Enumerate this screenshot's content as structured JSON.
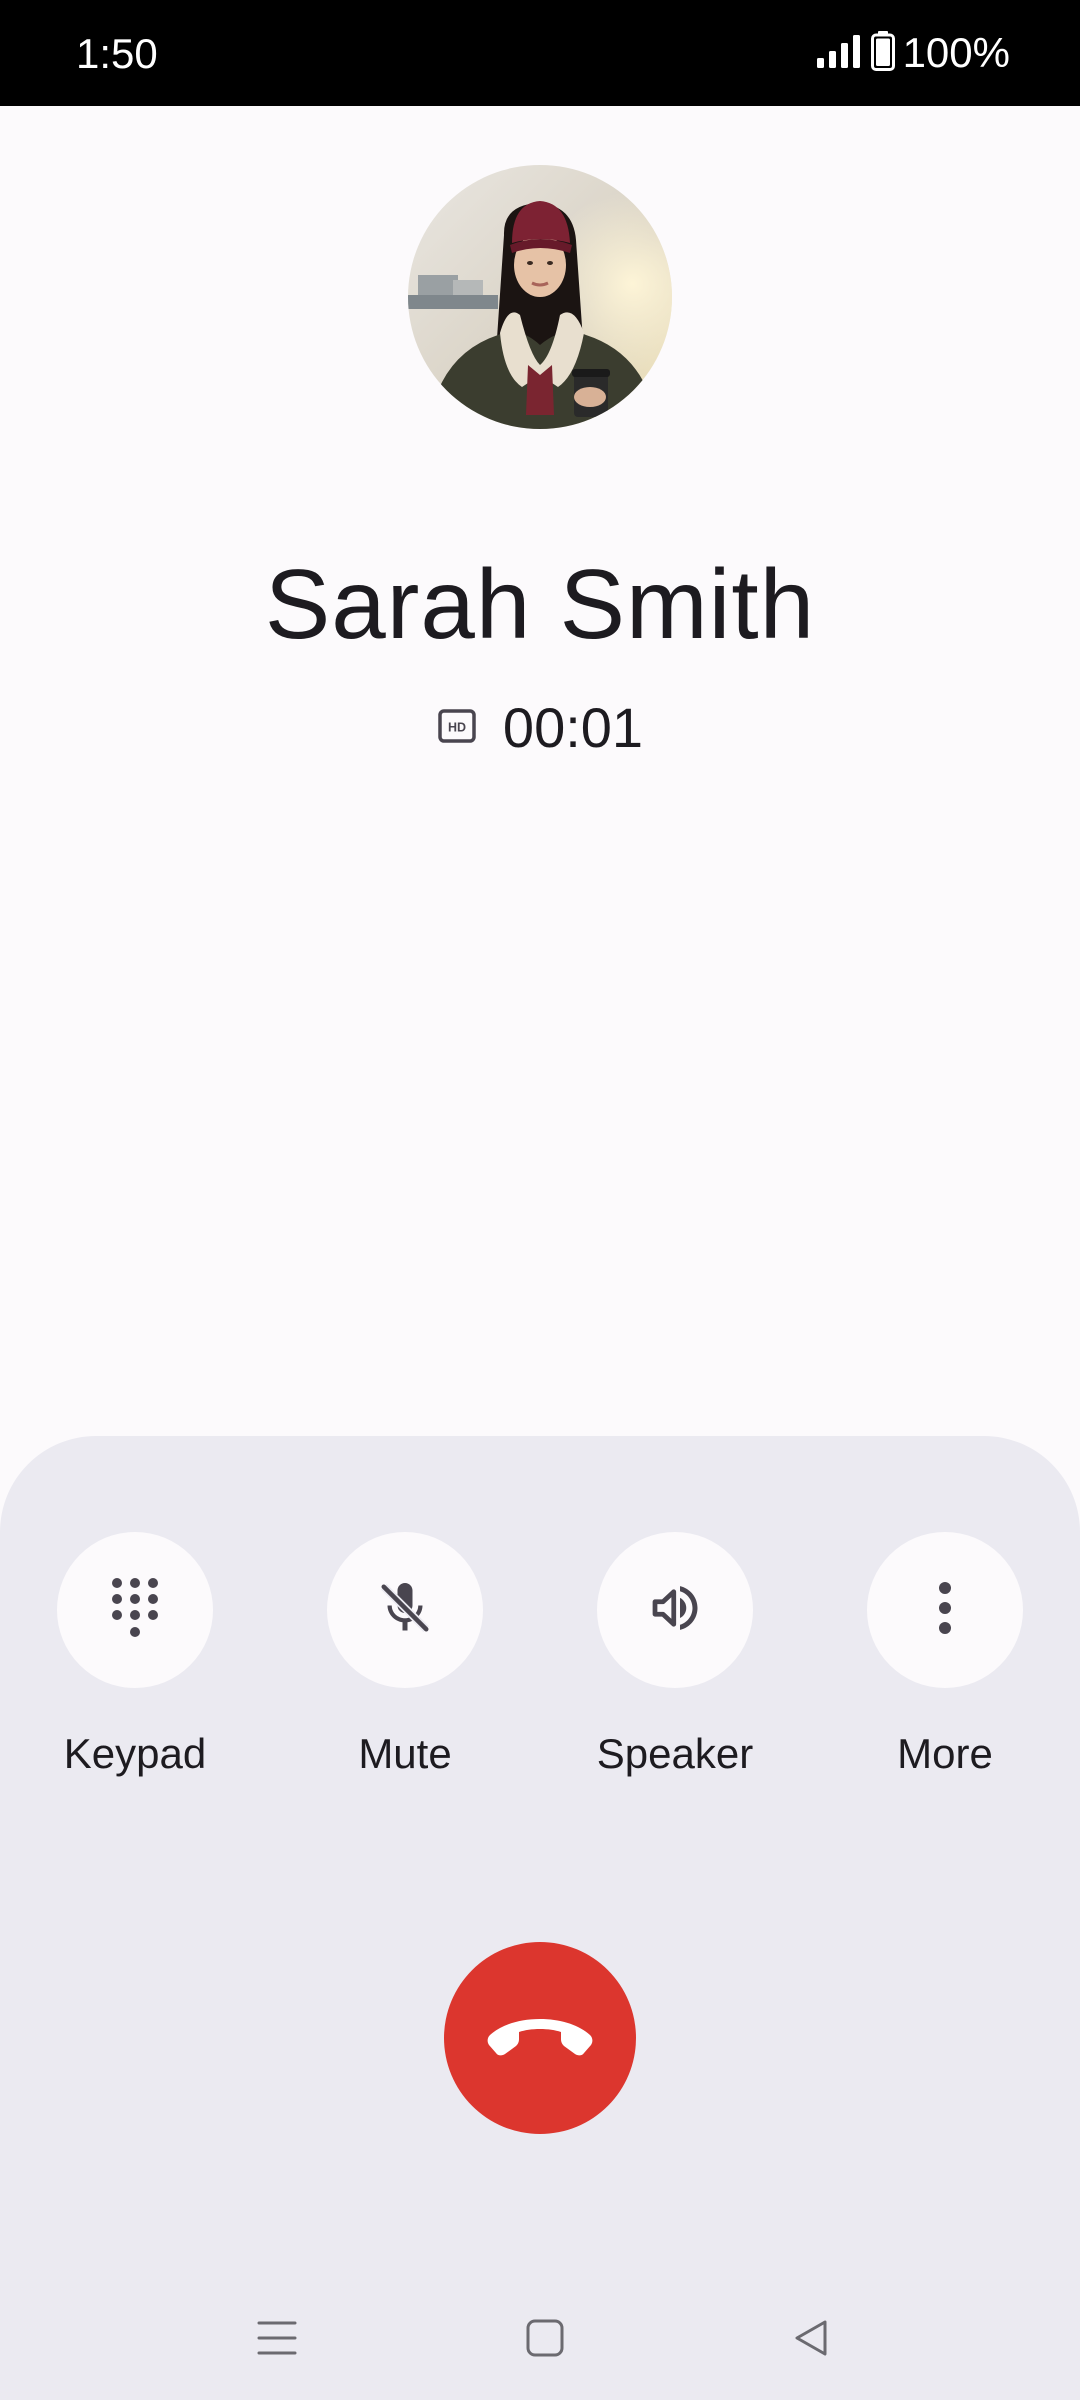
{
  "status_bar": {
    "time": "1:50",
    "battery": "100%"
  },
  "caller": {
    "name": "Sarah Smith",
    "timer": "00:01",
    "hd_badge": "hd-icon"
  },
  "controls": [
    {
      "label": "Keypad",
      "icon": "dialpad-icon"
    },
    {
      "label": "Mute",
      "icon": "mic-off-icon"
    },
    {
      "label": "Speaker",
      "icon": "speaker-icon"
    },
    {
      "label": "More",
      "icon": "more-vert-icon"
    }
  ],
  "end_call": {
    "icon": "call-end-icon",
    "color": "#dc362e"
  },
  "nav": {
    "icons": [
      "recents-icon",
      "home-icon",
      "back-icon"
    ]
  },
  "colors": {
    "background": "#fcfafc",
    "sheet": "#ebeaf1",
    "end_call": "#dc362e",
    "text": "#1d1b20"
  }
}
